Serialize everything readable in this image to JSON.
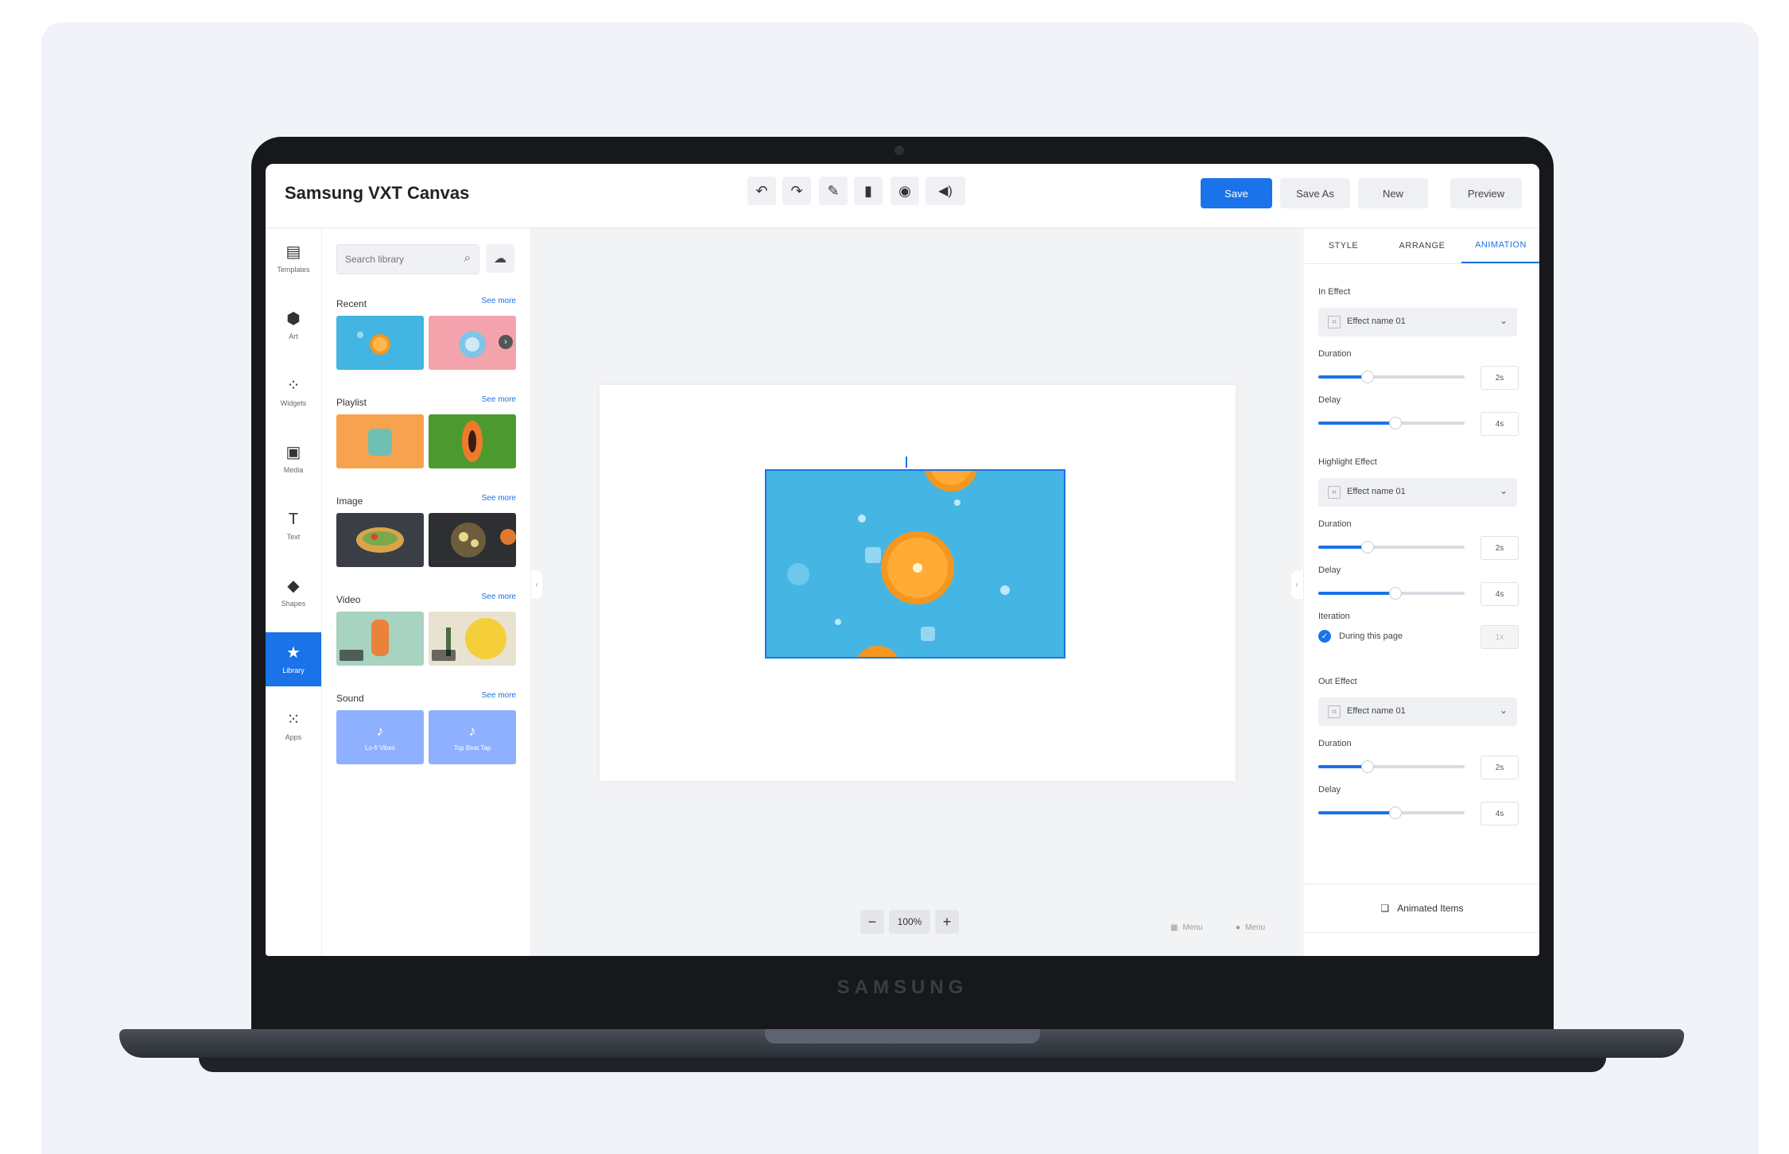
{
  "app": {
    "title": "Samsung VXT Canvas",
    "device_brand": "SAMSUNG"
  },
  "toolbar": {
    "tools": [
      {
        "icon": "undo-icon",
        "glyph": "↶"
      },
      {
        "icon": "redo-icon",
        "glyph": "↷"
      },
      {
        "icon": "pen-icon",
        "glyph": "✎"
      },
      {
        "icon": "delete-icon",
        "glyph": "▮"
      },
      {
        "icon": "record-icon",
        "glyph": "◉"
      },
      {
        "icon": "volume-icon",
        "glyph": "◀)"
      }
    ],
    "save_label": "Save",
    "save_as_label": "Save As",
    "new_label": "New",
    "preview_label": "Preview"
  },
  "rail": {
    "items": [
      {
        "label": "Templates",
        "icon": "templates-icon",
        "glyph": "▤"
      },
      {
        "label": "Art",
        "icon": "art-icon",
        "glyph": "⬢"
      },
      {
        "label": "Widgets",
        "icon": "widgets-icon",
        "glyph": "⁘"
      },
      {
        "label": "Media",
        "icon": "media-icon",
        "glyph": "▣"
      },
      {
        "label": "Text",
        "icon": "text-icon",
        "glyph": "T"
      },
      {
        "label": "Shapes",
        "icon": "shapes-icon",
        "glyph": "◆"
      },
      {
        "label": "Library",
        "icon": "star-icon",
        "glyph": "★",
        "active": true
      },
      {
        "label": "Apps",
        "icon": "apps-icon",
        "glyph": "⁙"
      }
    ]
  },
  "library": {
    "search_placeholder": "Search library",
    "see_more": "See more",
    "sections": [
      {
        "title": "Recent"
      },
      {
        "title": "Playlist"
      },
      {
        "title": "Image"
      },
      {
        "title": "Video"
      },
      {
        "title": "Sound"
      }
    ],
    "sounds": [
      "Lo-fi Vibes",
      "Top Beat Tap"
    ]
  },
  "canvas": {
    "zoom": "100%",
    "footer_left": "Menu",
    "footer_right": "Menu"
  },
  "properties": {
    "tabs": [
      "STYLE",
      "ARRANGE",
      "ANIMATION"
    ],
    "active_tab": "ANIMATION",
    "in_effect": {
      "label": "In Effect",
      "select": "Effect name 01",
      "duration_label": "Duration",
      "duration_value": "2s",
      "duration_fill": 0.33,
      "delay_label": "Delay",
      "delay_value": "4s",
      "delay_fill": 0.52
    },
    "highlight_effect": {
      "label": "Highlight Effect",
      "select": "Effect name 01",
      "duration_label": "Duration",
      "duration_value": "2s",
      "duration_fill": 0.33,
      "delay_label": "Delay",
      "delay_value": "4s",
      "delay_fill": 0.52,
      "iteration_label": "Iteration",
      "iteration_option": "During this page",
      "iteration_value": "1x"
    },
    "out_effect": {
      "label": "Out Effect",
      "select": "Effect name 01",
      "duration_label": "Duration",
      "duration_value": "2s",
      "duration_fill": 0.33,
      "delay_label": "Delay",
      "delay_value": "4s",
      "delay_fill": 0.52
    },
    "animated_items_label": "Animated Items"
  },
  "colors": {
    "accent": "#1a73e8",
    "image_bg": "#45b6e3",
    "orange": "#f5961e"
  }
}
